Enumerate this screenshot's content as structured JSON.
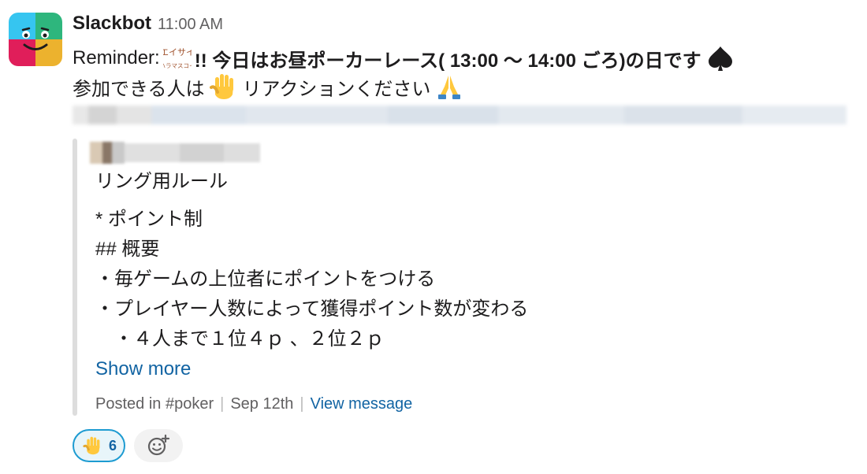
{
  "message": {
    "sender": "Slackbot",
    "time": "11:00 AM",
    "reminder_prefix": "Reminder:",
    "custom_emoji": {
      "name": "eisai-haramasukoi-emoji",
      "line1": "エイサイ",
      "line2": "ハラマスコイ"
    },
    "bold_text": "!! 今日はお昼ポーカーレース( 13:00 〜 14:00 ごろ)の日です",
    "spade_emoji": "spade-icon",
    "line2_before": "参加できる人は",
    "raised_hand_emoji": "raised-hand-icon",
    "line2_after": "リアクションください",
    "pray_emoji": "folded-hands-icon"
  },
  "quote": {
    "lines": [
      "リング用ルール",
      "* ポイント制",
      "## 概要",
      "・毎ゲームの上位者にポイントをつける",
      "・プレイヤー人数によって獲得ポイント数が変わる",
      "　・４人まで１位４ｐ 、２位２ｐ"
    ],
    "show_more": "Show more",
    "footer": {
      "posted_in": "Posted in #poker",
      "date": "Sep 12th",
      "view_message": "View message"
    }
  },
  "reactions": [
    {
      "emoji": "raised-hand-icon",
      "count": "6",
      "reacted": true
    }
  ],
  "colors": {
    "link": "#1264a3",
    "reaction_border": "#1d9bd1",
    "reaction_bg": "#e8f5fa",
    "quote_bar": "#dddddd",
    "muted_text": "#616061"
  }
}
